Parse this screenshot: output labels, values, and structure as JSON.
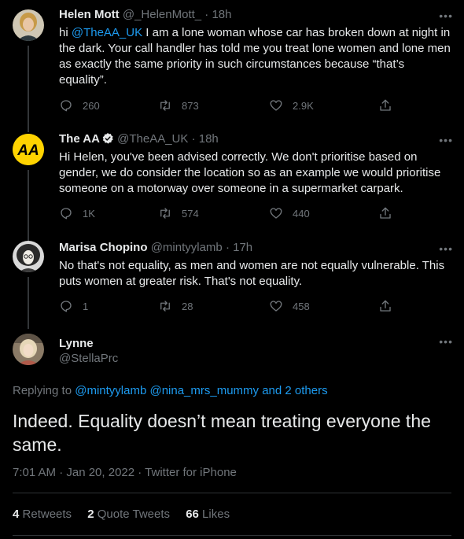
{
  "tweets": [
    {
      "name": "Helen Mott",
      "handle": "@_HelenMott_",
      "time": "18h",
      "mention": "@TheAA_UK",
      "text": " I am a lone woman whose car has broken down at night in the dark. Your call handler has told me you treat lone women and lone men as exactly the same priority in such circumstances because “that’s equality”.",
      "replies": "260",
      "retweets": "873",
      "likes": "2.9K"
    },
    {
      "name": "The AA",
      "handle": "@TheAA_UK",
      "time": "18h",
      "text": "Hi Helen, you've been advised correctly. We don't prioritise based on gender, we do consider the location so as an example we would prioritise someone on a motorway over someone in a supermarket carpark.",
      "replies": "1K",
      "retweets": "574",
      "likes": "440",
      "avatar_text": "AA"
    },
    {
      "name": "Marisa Chopino",
      "handle": "@mintyylamb",
      "time": "17h",
      "text": "No that's not equality, as men and women are not equally vulnerable. This puts women at greater risk. That's not equality.",
      "replies": "1",
      "retweets": "28",
      "likes": "458"
    }
  ],
  "main": {
    "name": "Lynne",
    "handle": "@StellaPrc",
    "replying_prefix": "Replying to ",
    "replying_mentions": "@mintyylamb @nina_mrs_mummy and 2 others",
    "text": "Indeed. Equality doesn’t mean treating everyone the same.",
    "meta": "7:01 AM · Jan 20, 2022 · Twitter for iPhone",
    "retweets_count": "4",
    "retweets_label": "Retweets",
    "quotes_count": "2",
    "quotes_label": "Quote Tweets",
    "likes_count": "66",
    "likes_label": "Likes"
  },
  "more_glyph": "•••",
  "separator": "·",
  "colors": {
    "background": "#000000",
    "accent": "#1d9bf0",
    "muted": "#71767b",
    "aa_yellow": "#ffd300"
  }
}
